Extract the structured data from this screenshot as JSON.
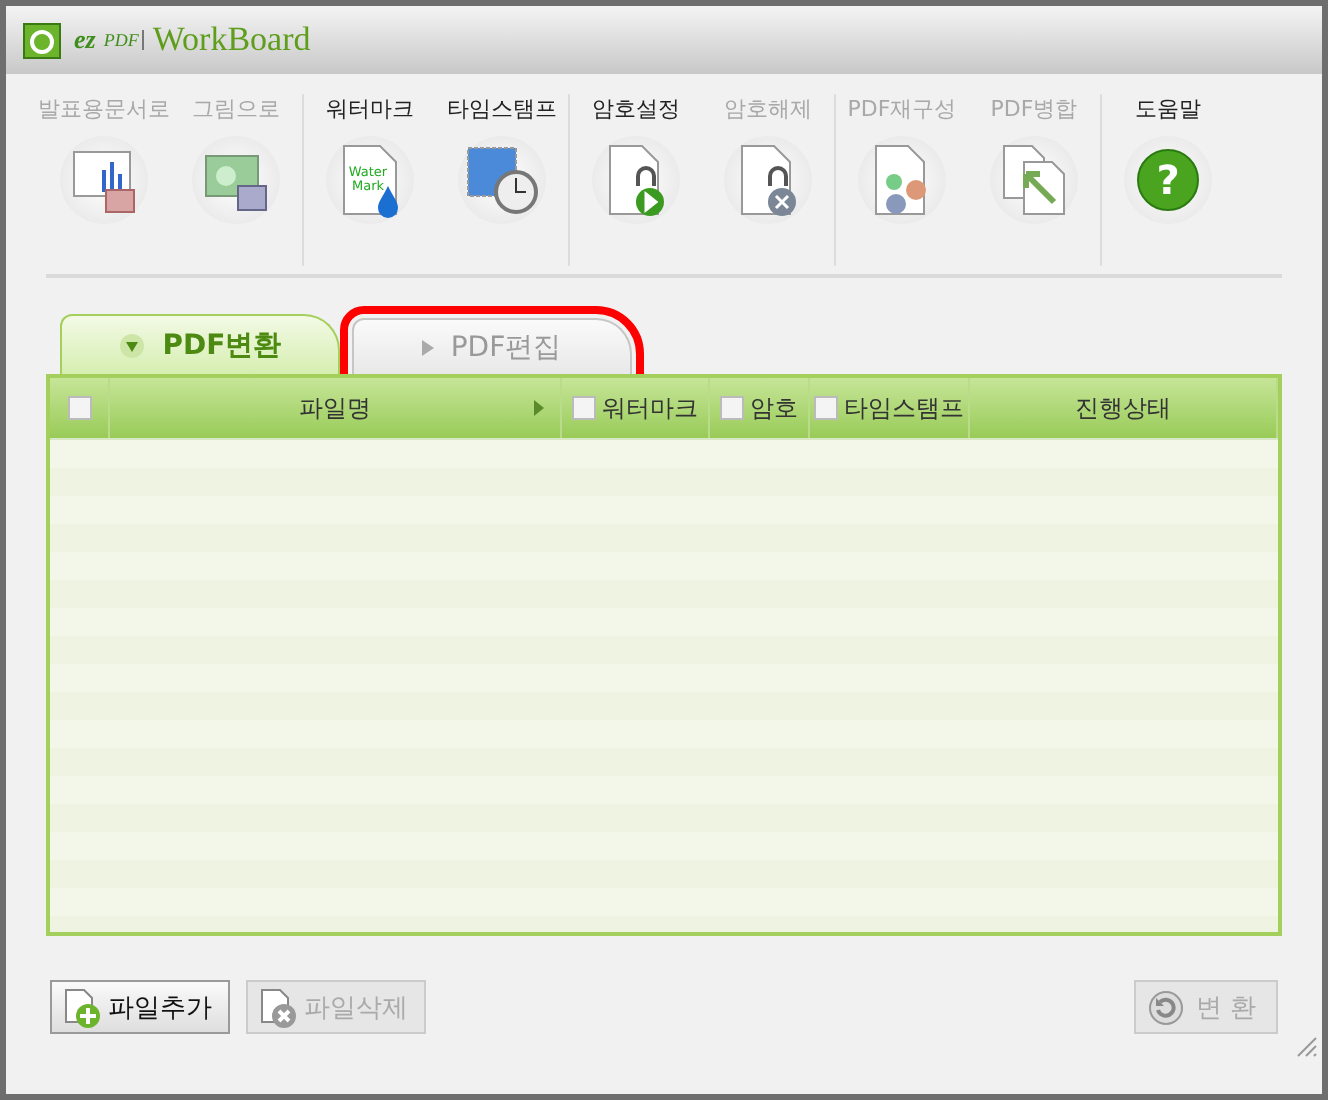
{
  "window": {
    "logo_small": "ez",
    "logo_pdf": "PDF",
    "title": "WorkBoard"
  },
  "toolbar": [
    [
      {
        "label": "발표용문서로",
        "kind": "chart",
        "disabled": true
      },
      {
        "label": "그림으로",
        "kind": "image",
        "disabled": true
      }
    ],
    [
      {
        "label": "워터마크",
        "kind": "watermark",
        "disabled": false,
        "icon_text": [
          "Water",
          "Mark"
        ]
      },
      {
        "label": "타임스탬프",
        "kind": "stamp",
        "disabled": false
      }
    ],
    [
      {
        "label": "암호설정",
        "kind": "lock",
        "disabled": false
      },
      {
        "label": "암호해제",
        "kind": "unlock",
        "disabled": true
      }
    ],
    [
      {
        "label": "PDF재구성",
        "kind": "rebuild",
        "disabled": true
      },
      {
        "label": "PDF병합",
        "kind": "merge",
        "disabled": true
      }
    ],
    [
      {
        "label": "도움말",
        "kind": "help",
        "disabled": false,
        "icon_text": [
          "?"
        ]
      }
    ]
  ],
  "tabs": [
    {
      "label": "PDF변환",
      "selected": true,
      "highlighted": false
    },
    {
      "label": "PDF편집",
      "selected": false,
      "highlighted": true
    }
  ],
  "table": {
    "columns": [
      {
        "kind": "check",
        "checked": false
      },
      {
        "kind": "text",
        "label": "파일명",
        "sort": true
      },
      {
        "kind": "check",
        "label": "워터마크",
        "checked": false
      },
      {
        "kind": "check",
        "label": "암호",
        "checked": false
      },
      {
        "kind": "check",
        "label": "타임스탬프",
        "checked": false
      },
      {
        "kind": "text",
        "label": "진행상태"
      }
    ]
  },
  "buttons_left": [
    {
      "label": "파일추가",
      "kind": "add",
      "disabled": false
    },
    {
      "label": "파일삭제",
      "kind": "remove",
      "disabled": true
    }
  ],
  "convert_button": {
    "label": "변 환",
    "disabled": true
  }
}
